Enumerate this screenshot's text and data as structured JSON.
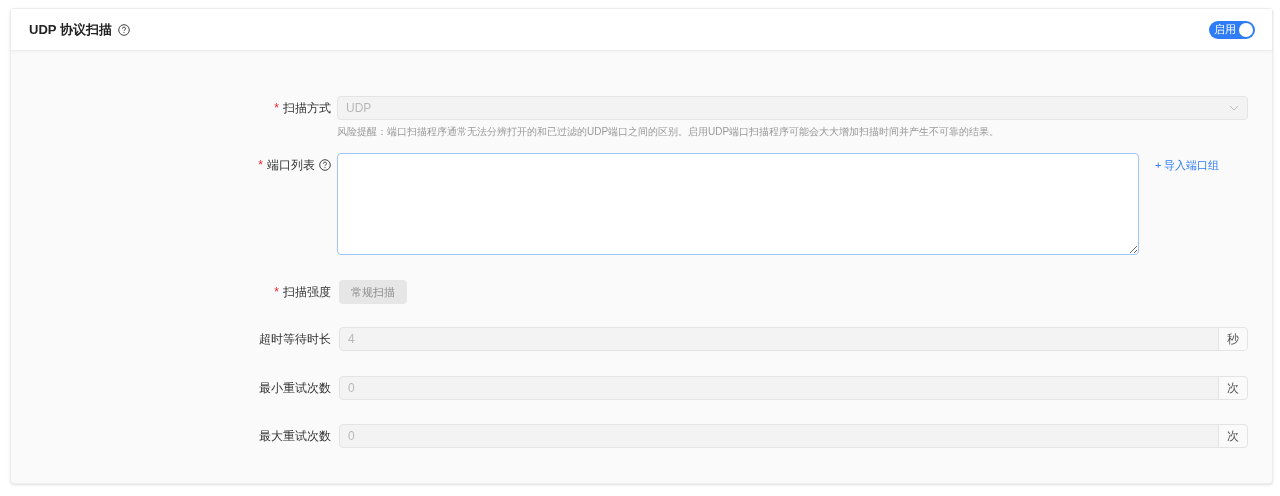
{
  "header": {
    "title": "UDP 协议扫描",
    "toggle": {
      "label": "启用",
      "on": true
    }
  },
  "fields": [
    {
      "kind": "select",
      "label": "扫描方式",
      "required_mark": "*",
      "value": "UDP",
      "disabled": true,
      "hint": "风险提醒：端口扫描程序通常无法分辨打开的和已过滤的UDP端口之间的区别。启用UDP端口扫描程序可能会大大增加扫描时间并产生不可靠的结果。"
    },
    {
      "kind": "textarea",
      "label": "端口列表",
      "required_mark": "*",
      "help": true,
      "link": "+ 导入端口组"
    },
    {
      "kind": "button",
      "label": "扫描强度",
      "required_mark": "*",
      "value": "常规扫描",
      "disabled": true
    },
    {
      "kind": "input",
      "label": "超时等待时长",
      "value": "4",
      "unit": "秒",
      "disabled": true
    },
    {
      "kind": "input",
      "label": "最小重试次数",
      "value": "0",
      "unit": "次",
      "disabled": true
    },
    {
      "kind": "input",
      "label": "最大重试次数",
      "value": "0",
      "unit": "次",
      "disabled": true
    }
  ]
}
